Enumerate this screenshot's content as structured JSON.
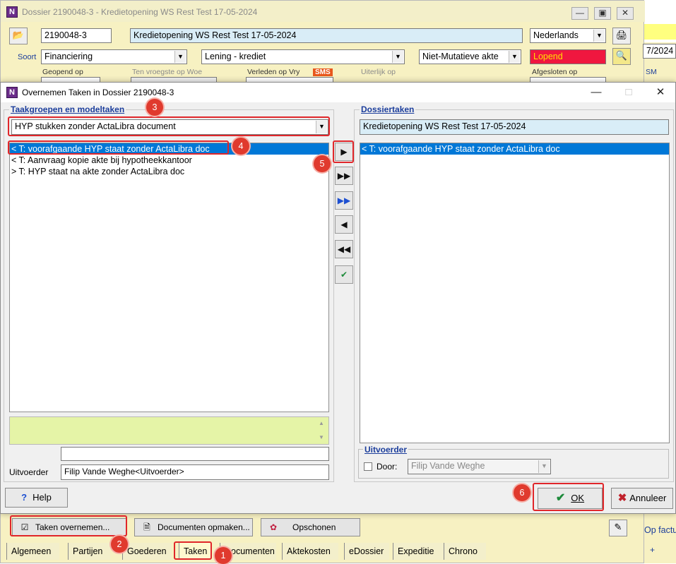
{
  "main": {
    "title": "Dossier 2190048-3 - Kredietopening  WS Rest Test 17-05-2024",
    "dossier_number": "2190048-3",
    "description": "Kredietopening  WS Rest Test 17-05-2024",
    "language": "Nederlands",
    "soort_label": "Soort",
    "soort": "Financiering",
    "subtype": "Lening - krediet",
    "akte_type": "Niet-Mutatieve akte",
    "status": "Lopend",
    "labels": {
      "geopend_op": "Geopend op",
      "ten_vroegste": "Ten vroegste op Woe",
      "verleden_op": "Verleden op Vry",
      "sms": "SMS",
      "uiterlijk_op": "Uiterlijk op",
      "afgesloten_op": "Afgesloten op"
    },
    "side_partial": {
      "date": "7/2024",
      "sm": "SM",
      "op_factu": "Op factu",
      "plus": "+"
    },
    "buttons": {
      "taken_overnemen": "Taken overnemen...",
      "documenten_opmaken": "Documenten opmaken...",
      "opschonen": "Opschonen"
    },
    "tabs": [
      "Algemeen",
      "Partijen",
      "Goederen",
      "Taken",
      "Documenten",
      "Aktekosten",
      "eDossier",
      "Expeditie",
      "Chrono"
    ]
  },
  "dialog": {
    "title": "Overnemen Taken in Dossier 2190048-3",
    "left_group_title": "Taakgroepen en modeltaken",
    "taakgroep_selected": "HYP stukken zonder ActaLibra document",
    "model_tasks": [
      "< T: voorafgaande HYP staat zonder ActaLibra doc",
      "< T: Aanvraag kopie akte bij hypotheekkantoor",
      "> T: HYP staat na akte zonder ActaLibra doc"
    ],
    "uitvoerder_label": "Uitvoerder",
    "uitvoerder_value": "Filip Vande Weghe<Uitvoerder>",
    "right_group_title": "Dossiertaken",
    "dossier_name": "Kredietopening  WS Rest Test 17-05-2024",
    "dossier_tasks": [
      "< T: voorafgaande HYP staat zonder ActaLibra doc"
    ],
    "uitvoerder_group_title": "Uitvoerder",
    "door_label": "Door:",
    "door_value": "Filip Vande Weghe",
    "buttons": {
      "help": "Help",
      "ok": "OK",
      "annuleer": "Annuleer"
    }
  },
  "annotations": [
    "1",
    "2",
    "3",
    "4",
    "5",
    "6"
  ],
  "colors": {
    "selection": "#0078d7",
    "highlight": "#e0262a",
    "status_bg": "#f0173f",
    "status_text": "#ffe000",
    "main_bg": "#f7f1c2",
    "memo_bg": "#e5f4a7",
    "group_title": "#1c3e9c"
  }
}
